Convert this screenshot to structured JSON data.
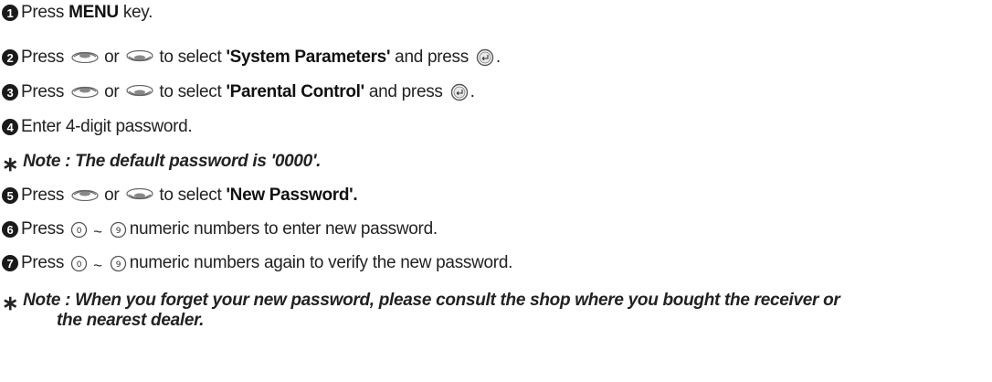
{
  "steps": [
    {
      "num": "1",
      "pre": "Press",
      "bold": "MENU",
      "post": "key."
    },
    {
      "num": "2",
      "pre": "Press",
      "or": "or",
      "mid": "to select",
      "bold": "'System Parameters'",
      "post": "and press",
      "end": "."
    },
    {
      "num": "3",
      "pre": "Press",
      "or": "or",
      "mid": "to select",
      "bold": "'Parental Control'",
      "post": "and press",
      "end": "."
    },
    {
      "num": "4",
      "text": "Enter 4-digit password."
    },
    {
      "num": "5",
      "pre": "Press",
      "or": "or",
      "mid": "to select",
      "bold": "'New Password'."
    },
    {
      "num": "6",
      "pre": "Press",
      "tilde": "~",
      "post": "numeric numbers to enter new password."
    },
    {
      "num": "7",
      "pre": "Press",
      "tilde": "~",
      "post": "numeric numbers again to verify the new password."
    }
  ],
  "notes": [
    {
      "star": "∗",
      "text": "Note : The default password is '0000'."
    },
    {
      "star": "∗",
      "text_line1": "Note : When you forget your new password, please consult the shop where you bought the receiver or",
      "text_line2": "the nearest dealer."
    }
  ],
  "icons": {
    "step_number": "filled-circle-number",
    "up_key": "up-rocker-key-icon",
    "down_key": "down-rocker-key-icon",
    "ok_key": "ok-enter-key-icon",
    "digit_0": "0",
    "digit_9": "9"
  }
}
